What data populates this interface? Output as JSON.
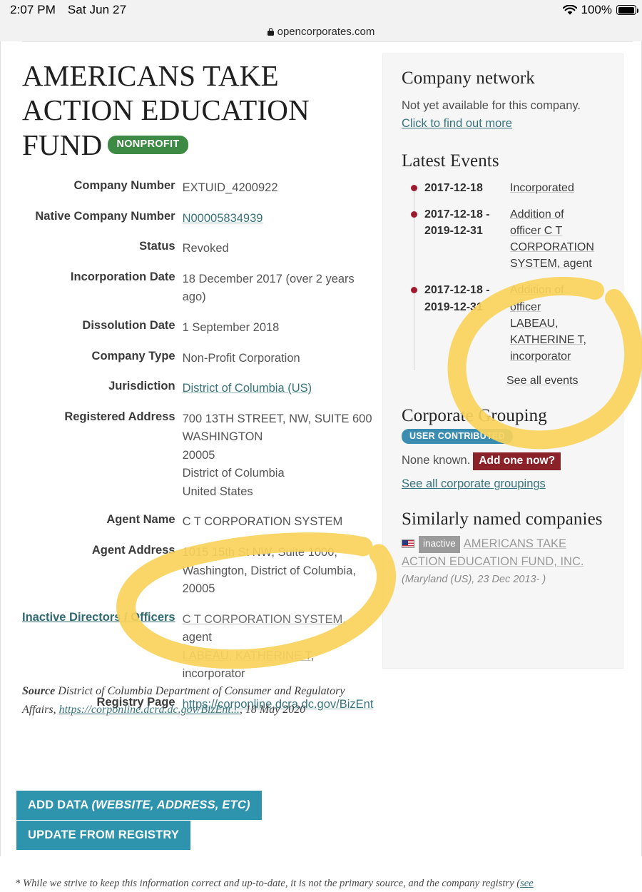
{
  "statusbar": {
    "time": "2:07 PM",
    "date": "Sat Jun 27",
    "battery_percent": "100%",
    "wifi_icon": "wifi-icon",
    "battery_icon": "battery-full-icon"
  },
  "browser": {
    "url": "opencorporates.com",
    "lock_icon": "lock-icon"
  },
  "company": {
    "title": "AMERICANS TAKE ACTION EDUCATION FUND",
    "badge": "NONPROFIT",
    "attributes": [
      {
        "label": "Company Number",
        "value": "EXTUID_4200922",
        "link": false
      },
      {
        "label": "Native Company Number",
        "value": "N00005834939",
        "link": true
      },
      {
        "label": "Status",
        "value": "Revoked",
        "link": false
      },
      {
        "label": "Incorporation Date",
        "value": "18 December 2017 (over 2 years ago)",
        "link": false
      },
      {
        "label": "Dissolution Date",
        "value": "1 September 2018",
        "link": false
      },
      {
        "label": "Company Type",
        "value": "Non-Profit Corporation",
        "link": false
      },
      {
        "label": "Jurisdiction",
        "value": "District of Columbia (US)",
        "link": true
      },
      {
        "label": "Registered Address",
        "value": "700 13TH STREET, NW, SUITE 600\nWASHINGTON\n20005\nDistrict of Columbia\nUnited States",
        "link": false
      },
      {
        "label": "Agent Name",
        "value": "C T CORPORATION SYSTEM",
        "link": false
      },
      {
        "label": "Agent Address",
        "value": "1015 15th St NW, Suite 1000, Washington, District of Columbia, 20005",
        "link": false
      }
    ],
    "inactive_officers_label": "Inactive Directors / Officers",
    "inactive_officers": [
      {
        "name": "C T CORPORATION SYSTEM",
        "role": "agent"
      },
      {
        "name": "LABEAU, KATHERINE T",
        "role": "incorporator"
      }
    ],
    "registry_page_label": "Registry Page",
    "registry_page_value": "https://corponline.dcra.dc.gov/BizEnt"
  },
  "source": {
    "label": "Source",
    "text_before": "District of Columbia Department of Consumer and Regulatory Affairs,",
    "link": "https://corponline.dcra.dc.gov/BizEnt...",
    "text_after": "18 May 2020"
  },
  "buttons": {
    "add_data_plain": "ADD DATA ",
    "add_data_italic": "(WEBSITE, ADDRESS, ETC)",
    "update_from_registry": "UPDATE FROM REGISTRY"
  },
  "footnote": "* While we strive to keep this information correct and up-to-date, it is not the primary source, and the company registry (",
  "footnote_link": "see",
  "sidebar": {
    "network": {
      "heading": "Company network",
      "text": "Not yet available for this company. ",
      "link": "Click to find out more"
    },
    "events": {
      "heading": "Latest Events",
      "items": [
        {
          "date": "2017-12-18",
          "description": "Incorporated"
        },
        {
          "date": "2017-12-18 - 2019-12-31",
          "description": "Addition of officer C T CORPORATION SYSTEM, agent"
        },
        {
          "date": "2017-12-18 - 2019-12-31",
          "description": "Addition of officer LABEAU, KATHERINE T, incorporator"
        }
      ],
      "see_all": "See all events"
    },
    "grouping": {
      "heading": "Corporate Grouping",
      "badge": "USER CONTRIBUTED",
      "none_known": "None known.",
      "add_one": "Add one now?",
      "see_all": "See all corporate groupings"
    },
    "similar": {
      "heading": "Similarly named companies",
      "flag_icon": "us-flag-icon",
      "status_tag": "inactive",
      "name": "AMERICANS TAKE ACTION EDUCATION FUND, INC.",
      "meta": "(Maryland (US), 23 Dec 2013- )"
    }
  },
  "colors": {
    "nonprofit_badge": "#3c8a43",
    "user_contributed_badge": "#3a8cb0",
    "add_one_button": "#8c2229",
    "action_button": "#2e93ac",
    "link": "#37737c",
    "event_dot": "#9e1b2f",
    "highlighter": "#f8d25a"
  }
}
